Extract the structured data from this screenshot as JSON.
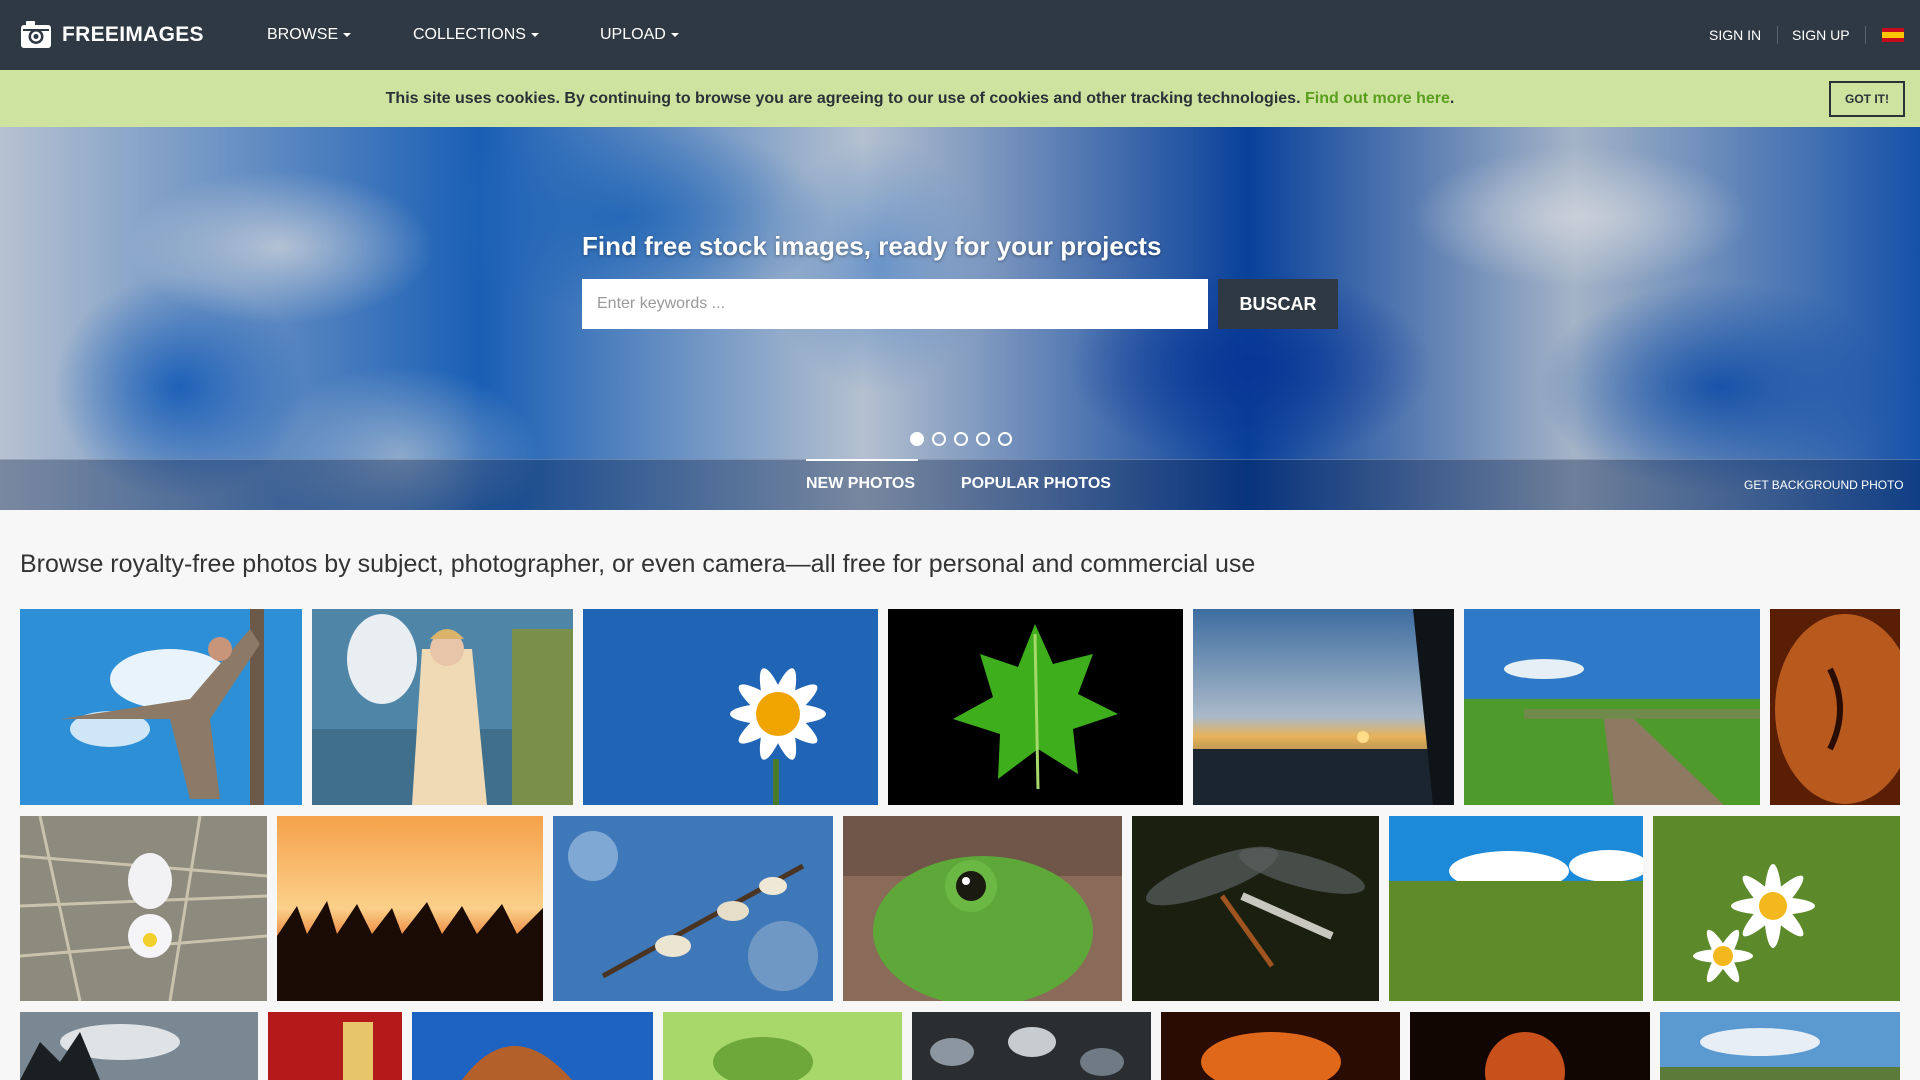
{
  "navbar": {
    "logo_text": "FREEIMAGES",
    "menu": [
      {
        "label": "BROWSE"
      },
      {
        "label": "COLLECTIONS"
      },
      {
        "label": "UPLOAD"
      }
    ],
    "sign_in": "SIGN IN",
    "sign_up": "SIGN UP",
    "language_flag": "spain-flag-icon"
  },
  "cookie_bar": {
    "message": "This site uses cookies. By continuing to browse you are agreeing to our use of cookies and other tracking technologies.",
    "link_text": "Find out more here",
    "link_suffix": ".",
    "button_label": "GOT IT!"
  },
  "hero": {
    "title": "Find free stock images, ready for your projects",
    "search_placeholder": "Enter keywords ...",
    "search_button": "BUSCAR",
    "carousel_dots": 5,
    "carousel_active_index": 0,
    "tabs": [
      {
        "label": "NEW PHOTOS",
        "active": true
      },
      {
        "label": "POPULAR PHOTOS",
        "active": false
      }
    ],
    "get_background_label": "GET BACKGROUND PHOTO"
  },
  "browse": {
    "heading": "Browse royalty-free photos by subject, photographer, or even camera—all free for personal and commercial use"
  },
  "colors": {
    "navbar_bg": "#2f3943",
    "cookie_bg": "#cfe3a0",
    "cookie_link": "#5a9e1e",
    "page_bg": "#f7f7f7"
  }
}
